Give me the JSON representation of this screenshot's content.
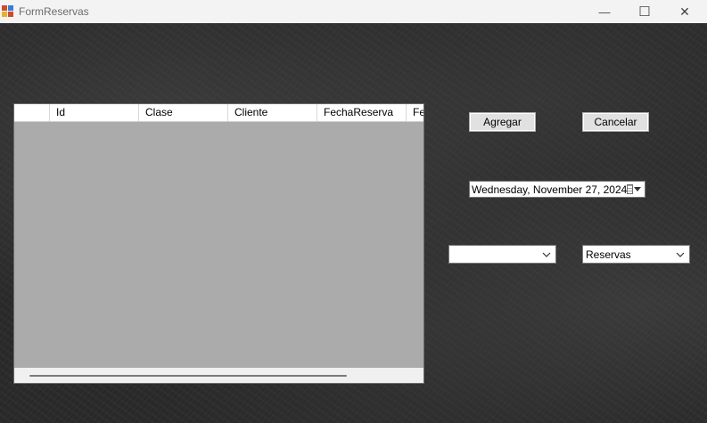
{
  "window": {
    "title": "FormReservas",
    "icon": "app-window-icon",
    "controls": {
      "minimize": "—",
      "maximize": "☐",
      "close": "✕"
    }
  },
  "grid": {
    "columns": [
      "",
      "Id",
      "Clase",
      "Cliente",
      "FechaReserva",
      "Fe"
    ],
    "rows": []
  },
  "buttons": {
    "agregar": "Agregar",
    "cancelar": "Cancelar"
  },
  "date_picker": {
    "value": "Wednesday,  November  27, 2024",
    "icon": "calendar-icon"
  },
  "combo_left": {
    "value": ""
  },
  "combo_right": {
    "value": "Reservas"
  },
  "colors": {
    "background": "#2b2b2b",
    "grid_empty": "#ababab",
    "button": "#e1e1e1"
  }
}
